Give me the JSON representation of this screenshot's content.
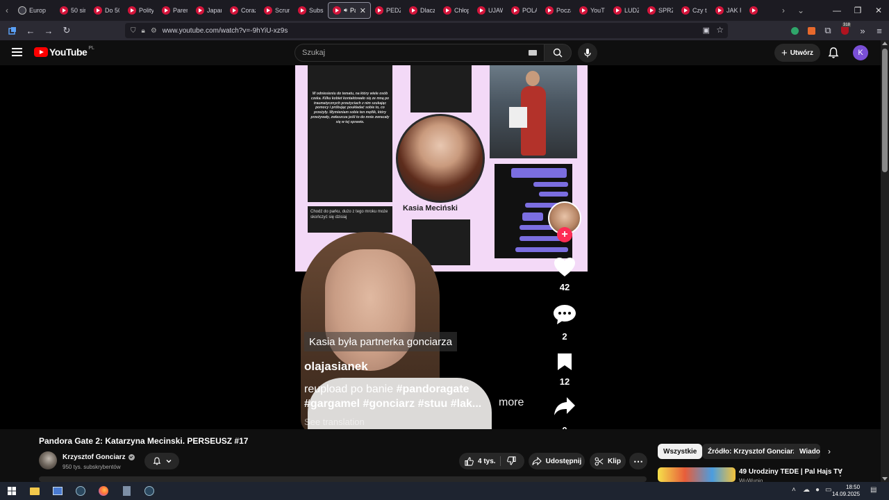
{
  "browser": {
    "tabs": [
      {
        "label": "Europ",
        "type": "globe"
      },
      {
        "label": "50 sin",
        "type": "yt"
      },
      {
        "label": "Do 50",
        "type": "yt"
      },
      {
        "label": "Polity",
        "type": "yt"
      },
      {
        "label": "Paren",
        "type": "yt"
      },
      {
        "label": "Japan",
        "type": "yt"
      },
      {
        "label": "Coraz",
        "type": "yt"
      },
      {
        "label": "Scrun",
        "type": "yt"
      },
      {
        "label": "Subsk",
        "type": "yt"
      },
      {
        "label": "Pan",
        "type": "yt",
        "active": true
      },
      {
        "label": "PEDZI",
        "type": "yt"
      },
      {
        "label": "Dlacz",
        "type": "yt"
      },
      {
        "label": "Chłop",
        "type": "yt"
      },
      {
        "label": "UJAW",
        "type": "yt"
      },
      {
        "label": "POLA",
        "type": "yt"
      },
      {
        "label": "Począ",
        "type": "yt"
      },
      {
        "label": "YouTu",
        "type": "yt"
      },
      {
        "label": "LUDZ",
        "type": "yt"
      },
      {
        "label": "SPRZ",
        "type": "yt"
      },
      {
        "label": "Czy ta",
        "type": "yt"
      },
      {
        "label": "JAK R",
        "type": "yt"
      },
      {
        "label": "",
        "type": "yt"
      }
    ],
    "url": "www.youtube.com/watch?v=-9hYiU-xz9s",
    "extension_badge": "318"
  },
  "youtube": {
    "logo_text": "YouTube",
    "country_code": "PL",
    "search_placeholder": "Szukaj",
    "create_label": "Utwórz",
    "avatar_letter": "K",
    "accent": "#ff0000"
  },
  "video": {
    "collage_name": "Kasia Meciński",
    "collage_letter_text": "W odniesieniu do tematu, na który wiele osób czeka. Kilku kobiet kontaktowało się ze mną po traumatycznych przeżyciach z nim szukając pomocy i próbując poukładać sobie to, co przeżyły. Wymieniam sobie ten mętlik, który przeżywały, zwłaszcza jeśli to do mnie zwracały się w tej sprawie.",
    "collage_chat_snippet": "Chodź do parku, dużo z tego mroku może skończyć się dzisiaj",
    "caption": "Kasia była partnerka gonciarza",
    "tiktok_user": "olajasianek",
    "description_plain": "reupload po banie ",
    "description_tags_1": "#pandoragate",
    "description_tags_2": "#gargamel #gonciarz #stuu #lak...",
    "more_label": "more",
    "see_translation": "See translation",
    "likes": "42",
    "comments": "2",
    "saves": "12",
    "shares": "0"
  },
  "watch": {
    "title": "Pandora Gate 2: Katarzyna Mecinski. PERSEUSZ #17",
    "channel_name": "Krzysztof Gonciarz",
    "subscribers": "950 tys. subskrybentów",
    "like_count": "4 tys.",
    "share_label": "Udostępnij",
    "clip_label": "Klip",
    "chips": [
      "Wszystkie",
      "Źródło: Krzysztof Gonciarz",
      "Wiado"
    ],
    "rec_title": "49 Urodziny TEDE | Pal Hajs TV",
    "rec_channel": "WuWunio"
  },
  "taskbar": {
    "time": "18:50",
    "date": "14.09.2025"
  }
}
